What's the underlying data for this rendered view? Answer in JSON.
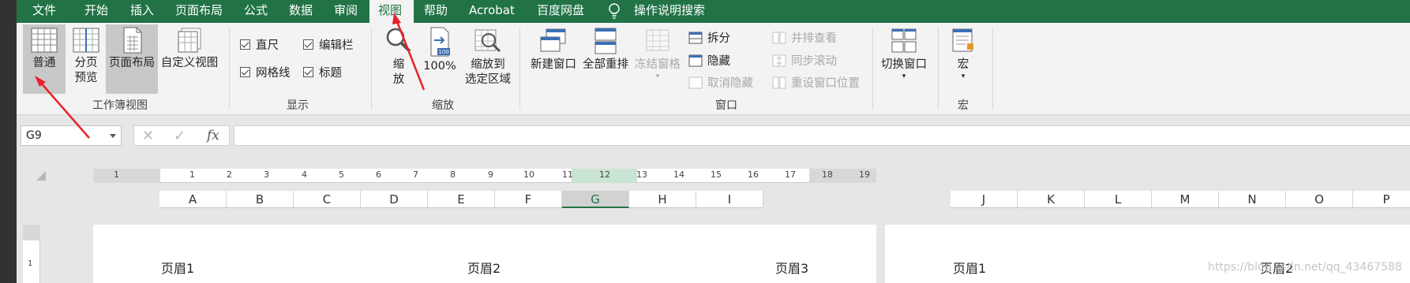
{
  "tabs": [
    "文件",
    "开始",
    "插入",
    "页面布局",
    "公式",
    "数据",
    "审阅",
    "视图",
    "帮助",
    "Acrobat",
    "百度网盘"
  ],
  "active_tab": "视图",
  "tell_me": "操作说明搜索",
  "ribbon": {
    "workbook_views": {
      "label": "工作簿视图",
      "normal": "普通",
      "page_break_line1": "分页",
      "page_break_line2": "预览",
      "page_layout": "页面布局",
      "custom": "自定义视图"
    },
    "show": {
      "label": "显示",
      "ruler": "直尺",
      "formula_bar": "编辑栏",
      "gridlines": "网格线",
      "headings": "标题"
    },
    "zoom": {
      "label": "缩放",
      "zoom_line1": "缩",
      "zoom_line2": "放",
      "hundred": "100%",
      "zoom_sel_line1": "缩放到",
      "zoom_sel_line2": "选定区域"
    },
    "window": {
      "label": "窗口",
      "new_window": "新建窗口",
      "arrange_all": "全部重排",
      "freeze": "冻结窗格",
      "split": "拆分",
      "hide": "隐藏",
      "unhide": "取消隐藏",
      "side_by_side": "并排查看",
      "sync_scroll": "同步滚动",
      "reset_pos": "重设窗口位置",
      "switch": "切换窗口"
    },
    "macros": {
      "label": "宏",
      "macro": "宏"
    }
  },
  "formula_bar": {
    "name_box": "G9",
    "fx": "fx",
    "formula": ""
  },
  "ruler": [
    "1",
    "1",
    "2",
    "3",
    "4",
    "5",
    "6",
    "7",
    "8",
    "9",
    "10",
    "11",
    "12",
    "13",
    "14",
    "15",
    "16",
    "17",
    "18",
    "19"
  ],
  "columns_page1": [
    "A",
    "B",
    "C",
    "D",
    "E",
    "F",
    "G",
    "H",
    "I"
  ],
  "columns_page2": [
    "J",
    "K",
    "L",
    "M",
    "N",
    "O",
    "P"
  ],
  "selected_column": "G",
  "page1_headers": [
    "页眉1",
    "页眉2",
    "页眉3"
  ],
  "page2_headers": [
    "页眉1",
    "页眉2"
  ],
  "watermark": "https://blog.csdn.net/qq_43467588",
  "colors": {
    "accent": "#217346",
    "annotation": "#e8212a"
  }
}
